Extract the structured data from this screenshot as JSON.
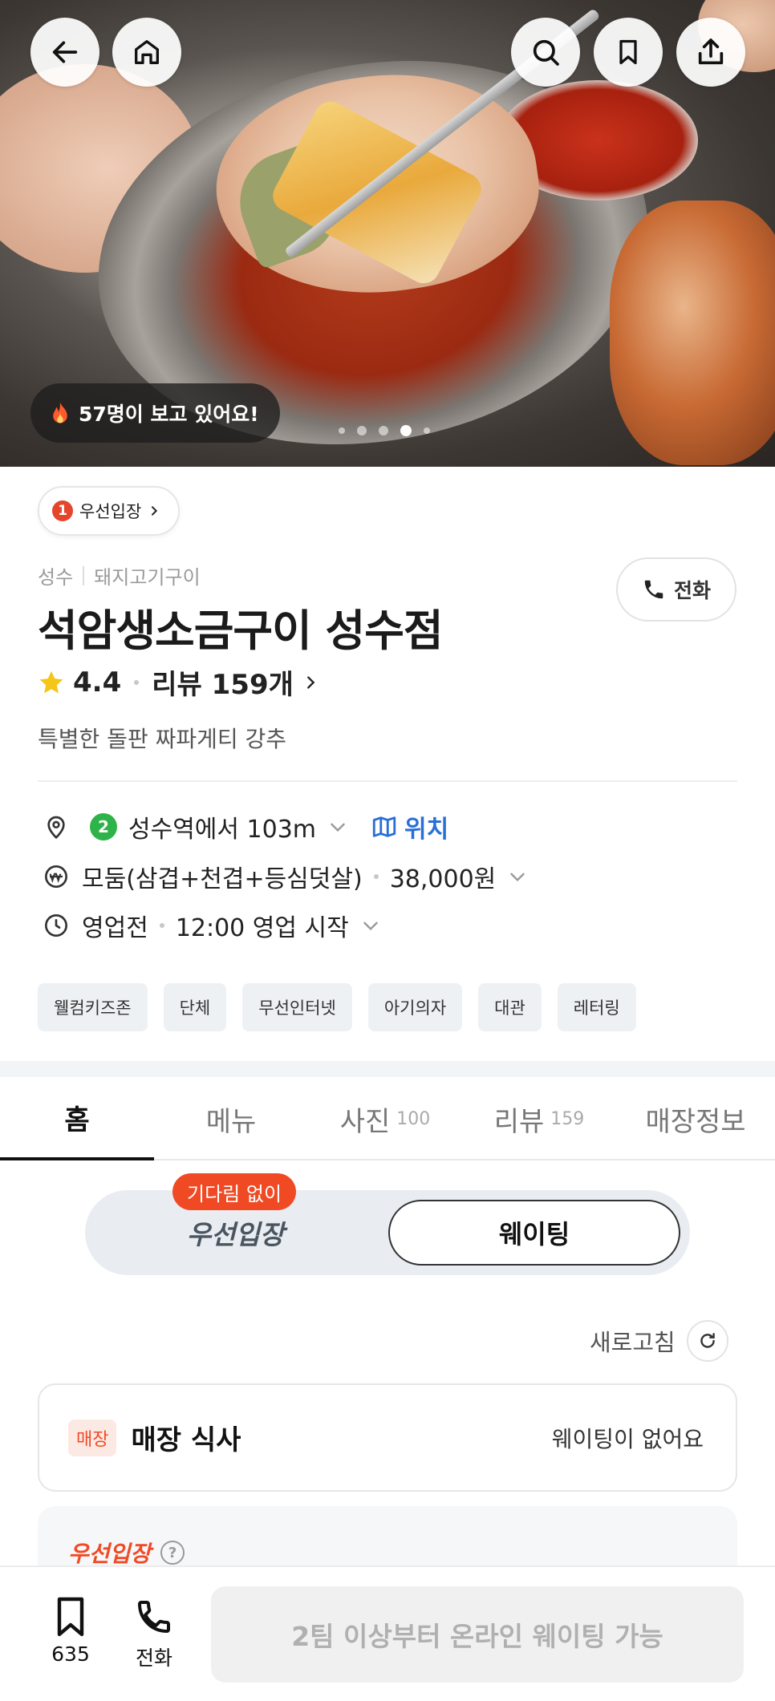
{
  "hero": {
    "viewers_text": "57명이 보고 있어요!",
    "carousel_total": 5,
    "carousel_active_index": 3
  },
  "priority_chip": {
    "number": "1",
    "label": "우선입장"
  },
  "shop": {
    "area": "성수",
    "category": "돼지고기구이",
    "name": "석암생소금구이 성수점",
    "rating": "4.4",
    "reviews": "리뷰 159개",
    "tagline": "특별한 돌판 짜파게티 강추",
    "call_label": "전화"
  },
  "info": {
    "subway_line": "2",
    "location": "성수역에서 103m",
    "map_label": "위치",
    "menu_name": "모둠(삼겹+천겹+등심덧살)",
    "menu_price": "38,000원",
    "hours_status": "영업전",
    "hours_text": "12:00 영업 시작"
  },
  "tags": [
    "웰컴키즈존",
    "단체",
    "무선인터넷",
    "아기의자",
    "대관",
    "레터링"
  ],
  "tabs": [
    {
      "label": "홈",
      "count": ""
    },
    {
      "label": "메뉴",
      "count": ""
    },
    {
      "label": "사진",
      "count": "100"
    },
    {
      "label": "리뷰",
      "count": "159"
    },
    {
      "label": "매장정보",
      "count": ""
    }
  ],
  "waiting": {
    "badge": "기다림 없이",
    "left_label": "우선입장",
    "right_label": "웨이팅"
  },
  "refresh_label": "새로고침",
  "store_card": {
    "badge": "매장",
    "title": "매장 식사",
    "status": "웨이팅이 없어요"
  },
  "priority_section": {
    "title": "우선입장",
    "help": "?"
  },
  "bottom_bar": {
    "bookmark_count": "635",
    "call_label": "전화",
    "cta": "2팀 이상부터 온라인 웨이팅 가능"
  },
  "colors": {
    "accent": "#f04a25",
    "subway_green": "#2db34a",
    "map_blue": "#2a6fd6",
    "star": "#f5c518"
  }
}
